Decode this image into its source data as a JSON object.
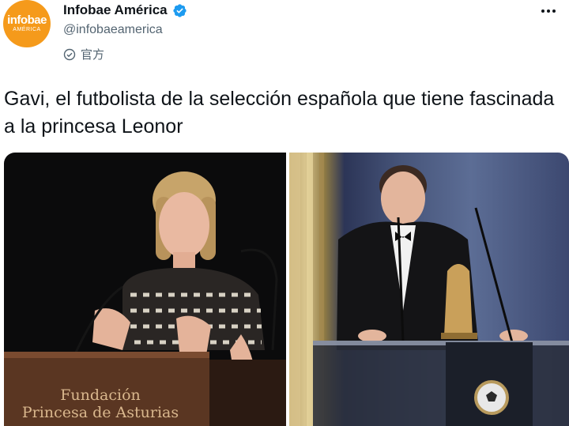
{
  "account": {
    "avatar_brand": "infobae",
    "avatar_region": "AMÉRICA",
    "display_name": "Infobae América",
    "handle": "@infobaeamerica",
    "official_label": "官方"
  },
  "tweet": {
    "text": "Gavi, el futbolista de la selección española que tiene fascinada a la princesa Leonor"
  },
  "media": {
    "left_lectern_line1": "Fundación",
    "left_lectern_line2": "Princesa de Asturias"
  },
  "colors": {
    "brand": "#f59a1b",
    "verified": "#1d9bf0",
    "muted_text": "#536471"
  },
  "icons": {
    "verified": "verified-badge-icon",
    "official": "check-circle-icon",
    "more": "more-horizontal-icon"
  }
}
